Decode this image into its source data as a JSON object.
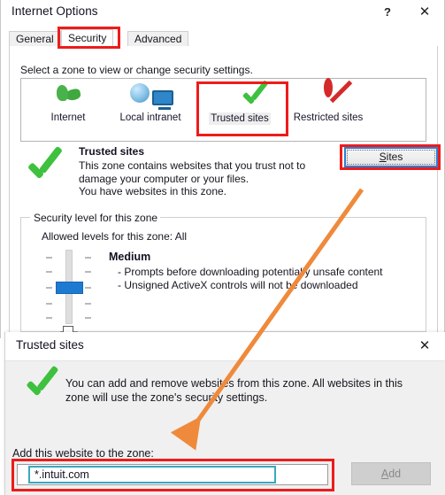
{
  "internet_options": {
    "title": "Internet Options",
    "help_icon": "?",
    "close_icon": "✕",
    "tabs": [
      {
        "id": "general",
        "label": "General",
        "active": false
      },
      {
        "id": "security",
        "label": "Security",
        "active": true
      },
      {
        "id": "advanced",
        "label": "Advanced",
        "active": false
      }
    ],
    "select_zone_label": "Select a zone to view or change security settings.",
    "zones": [
      {
        "id": "internet",
        "label": "Internet",
        "icon": "globe-icon",
        "selected": false
      },
      {
        "id": "intranet",
        "label": "Local intranet",
        "icon": "intranet-icon",
        "selected": false
      },
      {
        "id": "trusted",
        "label": "Trusted sites",
        "icon": "green-check-icon",
        "selected": true
      },
      {
        "id": "restricted",
        "label": "Restricted sites",
        "icon": "no-entry-icon",
        "selected": false
      }
    ],
    "selected_zone": {
      "name": "Trusted sites",
      "description": "This zone contains websites that you trust not to damage your computer or your files.\nYou have websites in this zone."
    },
    "sites_button": {
      "prefix": "",
      "accel": "S",
      "suffix": "ites",
      "label": "Sites"
    },
    "security_level": {
      "group_title": "Security level for this zone",
      "allowed_levels": "Allowed levels for this zone: All",
      "level_name": "Medium",
      "level_details": "- Prompts before downloading potentially unsafe content\n- Unsigned ActiveX controls will not be downloaded",
      "slider_position_label": "Medium"
    },
    "cut_off_row": {
      "checkbox_checked": false,
      "label": ""
    }
  },
  "trusted_sites_dialog": {
    "title": "Trusted sites",
    "close_icon": "✕",
    "info_text": "You can add and remove websites from this zone. All websites in this zone will use the zone's security settings.",
    "add_label": "Add this website to the zone:",
    "input": {
      "value": "*.intuit.com",
      "placeholder": ""
    },
    "add_button": {
      "prefix": "",
      "accel": "A",
      "suffix": "dd",
      "label": "Add",
      "disabled": true
    }
  },
  "annotations": {
    "highlight_color": "#ee1b1b",
    "arrow_color": "#ef8a3c",
    "focus_color": "#3aa8c0",
    "boxes": [
      {
        "name": "security-tab-highlight"
      },
      {
        "name": "trusted-sites-zone-highlight"
      },
      {
        "name": "sites-button-highlight"
      },
      {
        "name": "website-input-highlight"
      }
    ],
    "arrow": {
      "from": "sites-button",
      "to": "website-input"
    }
  }
}
